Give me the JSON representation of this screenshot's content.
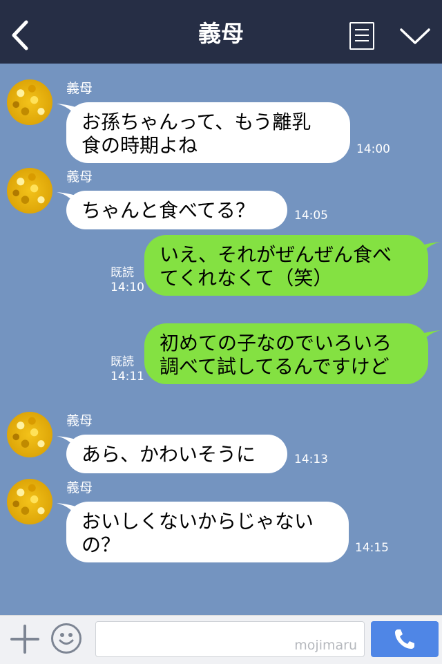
{
  "header": {
    "title": "義母",
    "back_icon": "chevron-left-icon",
    "menu_icon": "list-menu-icon",
    "collapse_icon": "chevron-down-icon"
  },
  "messages": [
    {
      "sender": "義母",
      "side": "in",
      "lines": [
        "お孫ちゃんって、もう離乳",
        "食の時期よね"
      ],
      "time": "14:00"
    },
    {
      "sender": "義母",
      "side": "in",
      "lines": [
        "ちゃんと食べてる？"
      ],
      "time": "14:05"
    },
    {
      "side": "out",
      "lines": [
        "いえ、それがぜんぜん食べ",
        "てくれなくて（笑）"
      ],
      "read": "既読",
      "time": "14:10"
    },
    {
      "side": "out",
      "lines": [
        "初めての子なのでいろいろ",
        "調べて試してるんですけど"
      ],
      "read": "既読",
      "time": "14:11"
    },
    {
      "sender": "義母",
      "side": "in",
      "lines": [
        "あら、かわいそうに"
      ],
      "time": "14:13"
    },
    {
      "sender": "義母",
      "side": "in",
      "lines": [
        "おいしくないからじゃない",
        "の？"
      ],
      "time": "14:15"
    }
  ],
  "footer": {
    "watermark": "mojimaru",
    "plus_icon": "plus-icon",
    "sticker_icon": "smiley-icon",
    "call_icon": "phone-icon"
  },
  "colors": {
    "header_bg": "#262e45",
    "chat_bg": "#7494c0",
    "incoming_bubble": "#ffffff",
    "outgoing_bubble": "#84e142",
    "call_button": "#4f86e6"
  }
}
